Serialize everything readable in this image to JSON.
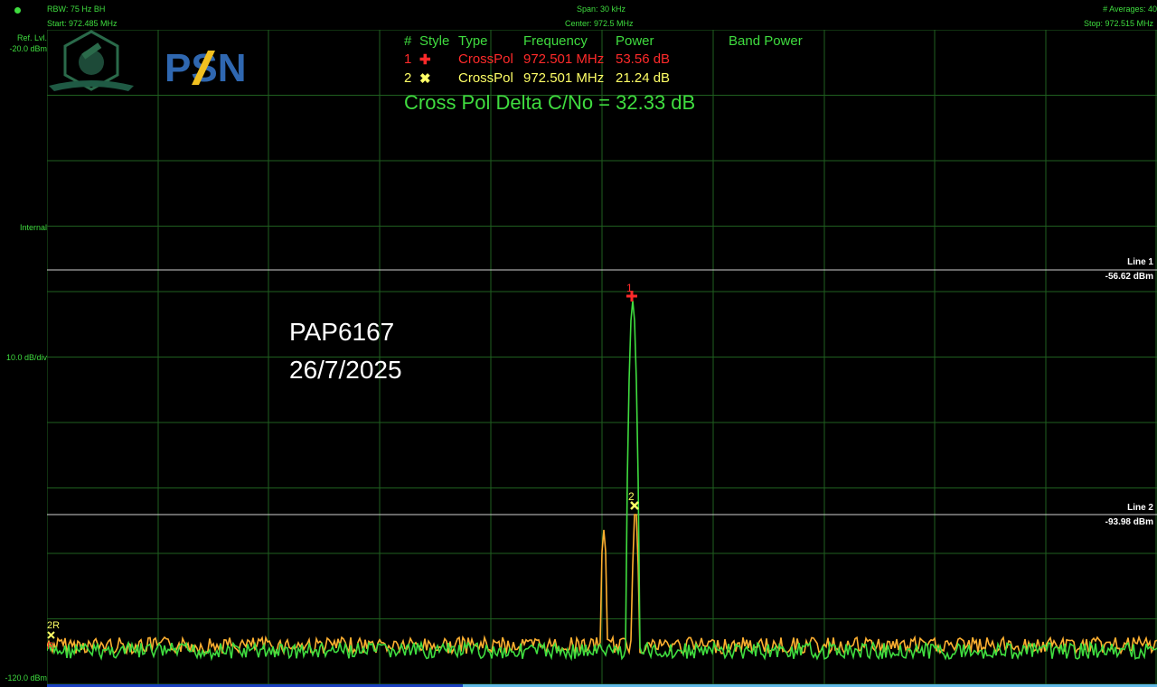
{
  "header": {
    "rbw": "RBW: 75 Hz BH",
    "start": "Start: 972.485 MHz",
    "span": "Span: 30 kHz",
    "center": "Center: 972.5 MHz",
    "averages": "# Averages: 40",
    "stop": "Stop: 972.515 MHz"
  },
  "left_axis": {
    "ref_lvl_label": "Ref. Lvl.",
    "ref_lvl_value": "-20.0 dBm",
    "internal": "Internal",
    "scale": "10.0 dB/div",
    "bottom": "-120.0 dBm"
  },
  "marker_table": {
    "headers": [
      "#",
      "Style",
      "Type",
      "Frequency",
      "Power",
      "Band Power"
    ],
    "rows": [
      {
        "num": "1",
        "symbol": "✚",
        "type": "CrossPol",
        "frequency": "972.501 MHz",
        "power": "53.56 dB",
        "color": "#ff2a2a"
      },
      {
        "num": "2",
        "symbol": "✖",
        "type": "CrossPol",
        "frequency": "972.501 MHz",
        "power": "21.24 dB",
        "color": "#ffff66"
      }
    ]
  },
  "delta_text": "Cross Pol Delta C/No = 32.33 dB",
  "annotation": {
    "line1": "PAP6167",
    "line2": "26/7/2025"
  },
  "lines": [
    {
      "name": "Line 1",
      "value": "-56.62 dBm"
    },
    {
      "name": "Line 2",
      "value": "-93.98 dBm"
    }
  ],
  "marker_labels": {
    "m1": "1",
    "m2": "2",
    "ref_2r": "2R",
    "ref_r": "R"
  },
  "logos": {
    "psn_text": "PSN"
  },
  "colors": {
    "grid": "#1f5f1f",
    "trace_green": "#3fdc3f",
    "trace_orange": "#ffb030",
    "marker1": "#ff2a2a",
    "marker2": "#ffff66"
  }
}
